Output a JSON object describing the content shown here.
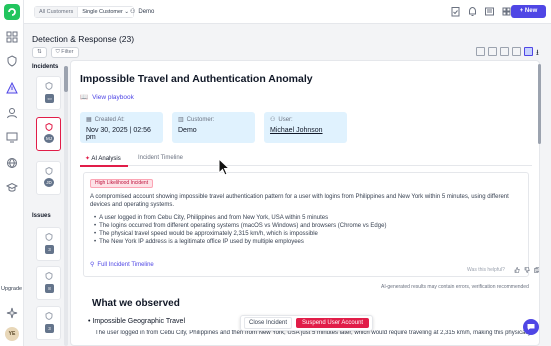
{
  "topbar": {
    "scope_all": "All Customers",
    "scope_single": "Single Customer",
    "tenant": "Demo",
    "new_label": "+ New"
  },
  "page": {
    "title": "Detection & Response (23)",
    "filter_label": "Filter"
  },
  "sidebar": {
    "upgrade_label": "Upgrade",
    "user_initials": "YE"
  },
  "list": {
    "incidents_label": "Incidents",
    "issues_label": "Issues",
    "incident_cards": [
      {
        "initials": ""
      },
      {
        "initials": "MJ"
      },
      {
        "initials": "JD"
      }
    ],
    "issue_cards": [
      {
        "count": "3"
      },
      {
        "count": "8"
      },
      {
        "count": "3"
      }
    ]
  },
  "detail": {
    "title": "Impossible Travel and Authentication Anomaly",
    "playbook_label": "View playbook",
    "created_label": "Created At:",
    "created_value": "Nov 30, 2025 | 02:56 pm",
    "customer_label": "Customer:",
    "customer_value": "Demo",
    "user_label": "User:",
    "user_value": "Michael Johnson",
    "tab_ai": "AI Analysis",
    "tab_timeline": "Incident Timeline",
    "badge": "High Likelihood Incident",
    "summary": "A compromised account showing impossible travel authentication pattern for a user with logins from Philippines and New York within 5 minutes, using different devices and operating systems.",
    "bullets": [
      "A user logged in from Cebu City, Philippines and from New York, USA within 5 minutes",
      "The logins occurred from different operating systems (macOS vs Windows) and browsers (Chrome vs Edge)",
      "The physical travel speed would be approximately 2,315 km/h, which is impossible",
      "The New York IP address is a legitimate office IP used by multiple employees"
    ],
    "timeline_link": "Full Incident Timeline",
    "helpful": "Was this helpful?",
    "disclaimer": "AI-generated results may contain errors, verification recommended",
    "observed_title": "What we observed",
    "observed_bullet": "Impossible Geographic Travel",
    "observed_text": "The user logged in from Cebu City, Philippines and then from New York, USA just 5 minutes later, which would require traveling at 2,315 km/h, making this physically impossible."
  },
  "actions": {
    "close_label": "Close Incident",
    "suspend_label": "Suspend User Account"
  },
  "colors": {
    "accent": "#4f46e5",
    "danger": "#e11d48",
    "brand": "#22c55e"
  }
}
